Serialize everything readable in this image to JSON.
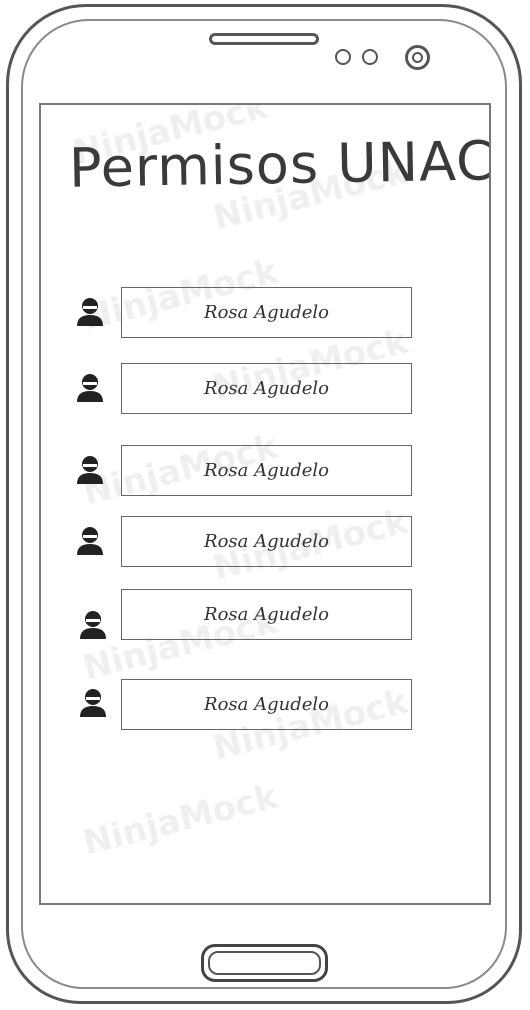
{
  "screen": {
    "title": "Permisos UNAC",
    "watermark_text": "NinjaMock"
  },
  "users": [
    {
      "name": "Rosa Agudelo"
    },
    {
      "name": "Rosa Agudelo"
    },
    {
      "name": "Rosa Agudelo"
    },
    {
      "name": "Rosa Agudelo"
    },
    {
      "name": "Rosa Agudelo"
    },
    {
      "name": "Rosa Agudelo"
    }
  ],
  "icons": {
    "user": "user-avatar-icon"
  },
  "colors": {
    "ink": "#333333",
    "frame": "#555555"
  }
}
